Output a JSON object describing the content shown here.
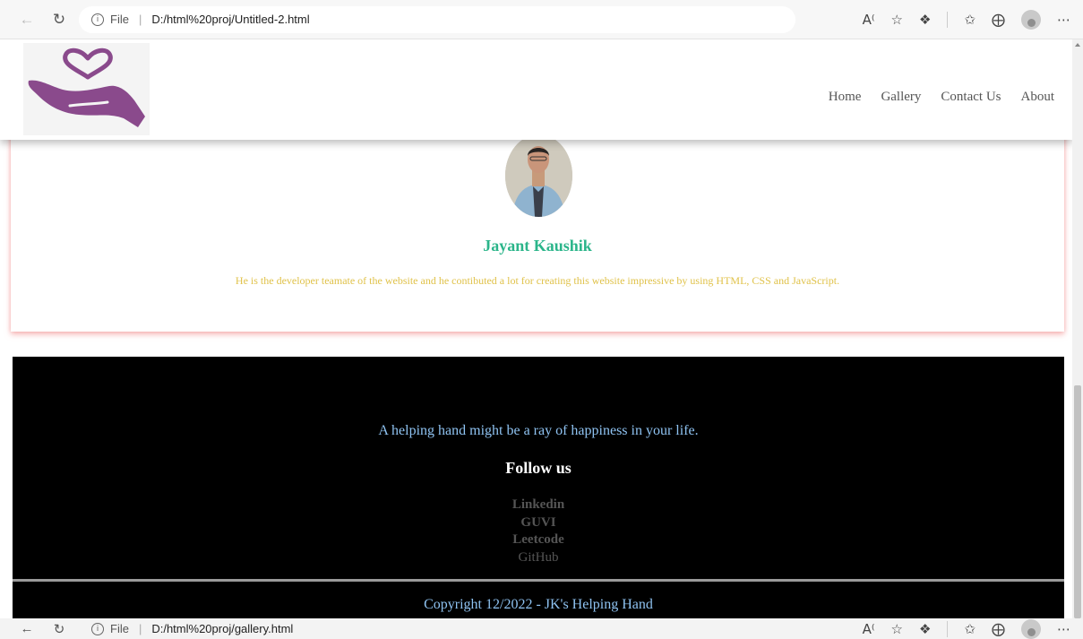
{
  "browser_top": {
    "file_label": "File",
    "url": "D:/html%20proj/Untitled-2.html"
  },
  "browser_bottom": {
    "file_label": "File",
    "url": "D:/html%20proj/gallery.html"
  },
  "icons": [
    "back-icon",
    "refresh-icon",
    "info-icon",
    "read-aloud-icon",
    "add-favorite-icon",
    "extensions-icon",
    "favorites-icon",
    "collections-icon",
    "profile-icon",
    "more-icon"
  ],
  "site": {
    "nav": [
      "Home",
      "Gallery",
      "Contact Us",
      "About"
    ],
    "profile": {
      "name": "Jayant Kaushik",
      "description": "He is the developer teamate of the website and he contibuted a lot for creating this website impressive by using HTML, CSS and JavaScript."
    },
    "footer": {
      "tagline": "A helping hand might be a ray of happiness in your life.",
      "follow_heading": "Follow us",
      "links": [
        "Linkedin",
        "GUVI",
        "Leetcode",
        "GitHub"
      ],
      "copyright": "Copyright 12/2022 - JK's Helping Hand"
    }
  },
  "colors": {
    "name": "#2bb58a",
    "description": "#e0c24a",
    "logo": "#8a4a8c",
    "footer_bg": "#000000",
    "footer_text": "#8fc3f2"
  }
}
